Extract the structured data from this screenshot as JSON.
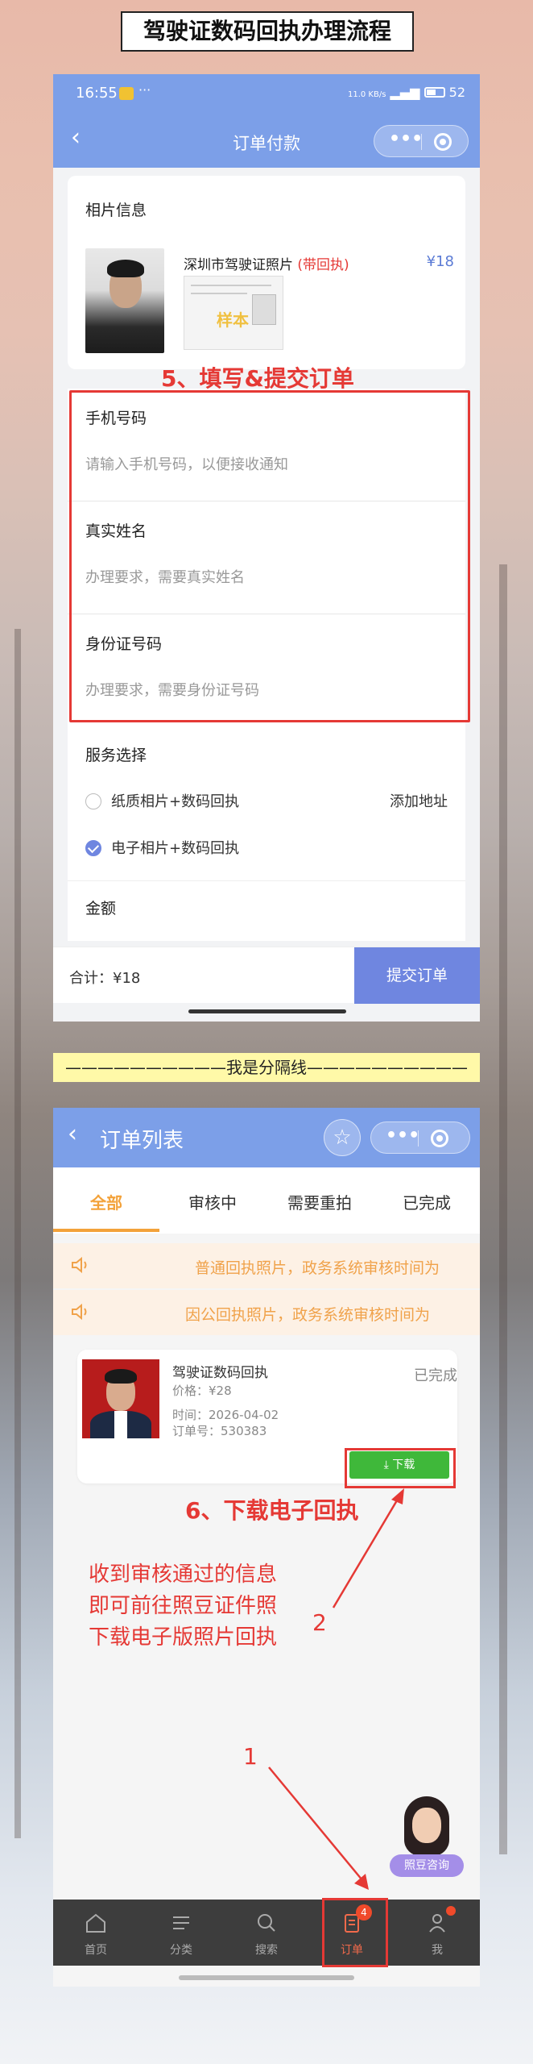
{
  "banner_title": "驾驶证数码回执办理流程",
  "phone1": {
    "status_bar": {
      "time": "16:55",
      "net_speed": "11.0 KB/s",
      "battery": "52"
    },
    "nav": {
      "title": "订单付款",
      "more_icon": "more-dots-icon",
      "target_icon": "target-icon"
    },
    "photo_info": {
      "section_title": "相片信息",
      "product_name": "深圳市驾驶证照片",
      "product_tag": "(带回执)",
      "price": "¥18",
      "sample_stamp": "样本"
    },
    "step_label": "5、填写&提交订单",
    "form": {
      "phone": {
        "label": "手机号码",
        "placeholder": "请输入手机号码，以便接收通知"
      },
      "name": {
        "label": "真实姓名",
        "placeholder": "办理要求，需要真实姓名"
      },
      "id_card": {
        "label": "身份证号码",
        "placeholder": "办理要求，需要身份证号码"
      }
    },
    "service": {
      "title": "服务选择",
      "options": [
        {
          "label": "纸质相片+数码回执",
          "checked": false
        },
        {
          "label": "电子相片+数码回执",
          "checked": true
        }
      ],
      "add_address": "添加地址",
      "amount_label": "金额"
    },
    "bottom": {
      "total": "合计：¥18",
      "submit": "提交订单"
    }
  },
  "divider_text": "——————————我是分隔线——————————",
  "phone2": {
    "nav": {
      "title": "订单列表"
    },
    "tabs": [
      "全部",
      "审核中",
      "需要重拍",
      "已完成"
    ],
    "active_tab": 0,
    "notices": [
      "普通回执照片，政务系统审核时间为",
      "因公回执照片，政务系统审核时间为"
    ],
    "order": {
      "name": "驾驶证数码回执",
      "status": "已完成",
      "price": "价格：¥28",
      "time": "时间：2026-04-02",
      "order_no": "订单号：530383",
      "download": "⤓ 下载"
    },
    "step_label": "6、下载电子回执",
    "explain": [
      "收到审核通过的信息",
      "即可前往照豆证件照",
      "下载电子版照片回执"
    ],
    "markers": [
      "2",
      "1"
    ],
    "consult_tag": "照豆咨询",
    "tabbar": [
      {
        "label": "首页",
        "icon": "home-icon"
      },
      {
        "label": "分类",
        "icon": "list-icon"
      },
      {
        "label": "搜索",
        "icon": "search-icon"
      },
      {
        "label": "订单",
        "icon": "order-icon",
        "badge": "4"
      },
      {
        "label": "我",
        "icon": "profile-icon"
      }
    ]
  },
  "colors": {
    "accent_blue": "#7c9fe8",
    "annotation_red": "#e53935",
    "tab_orange": "#f3a23a",
    "download_green": "#3fb83a"
  }
}
